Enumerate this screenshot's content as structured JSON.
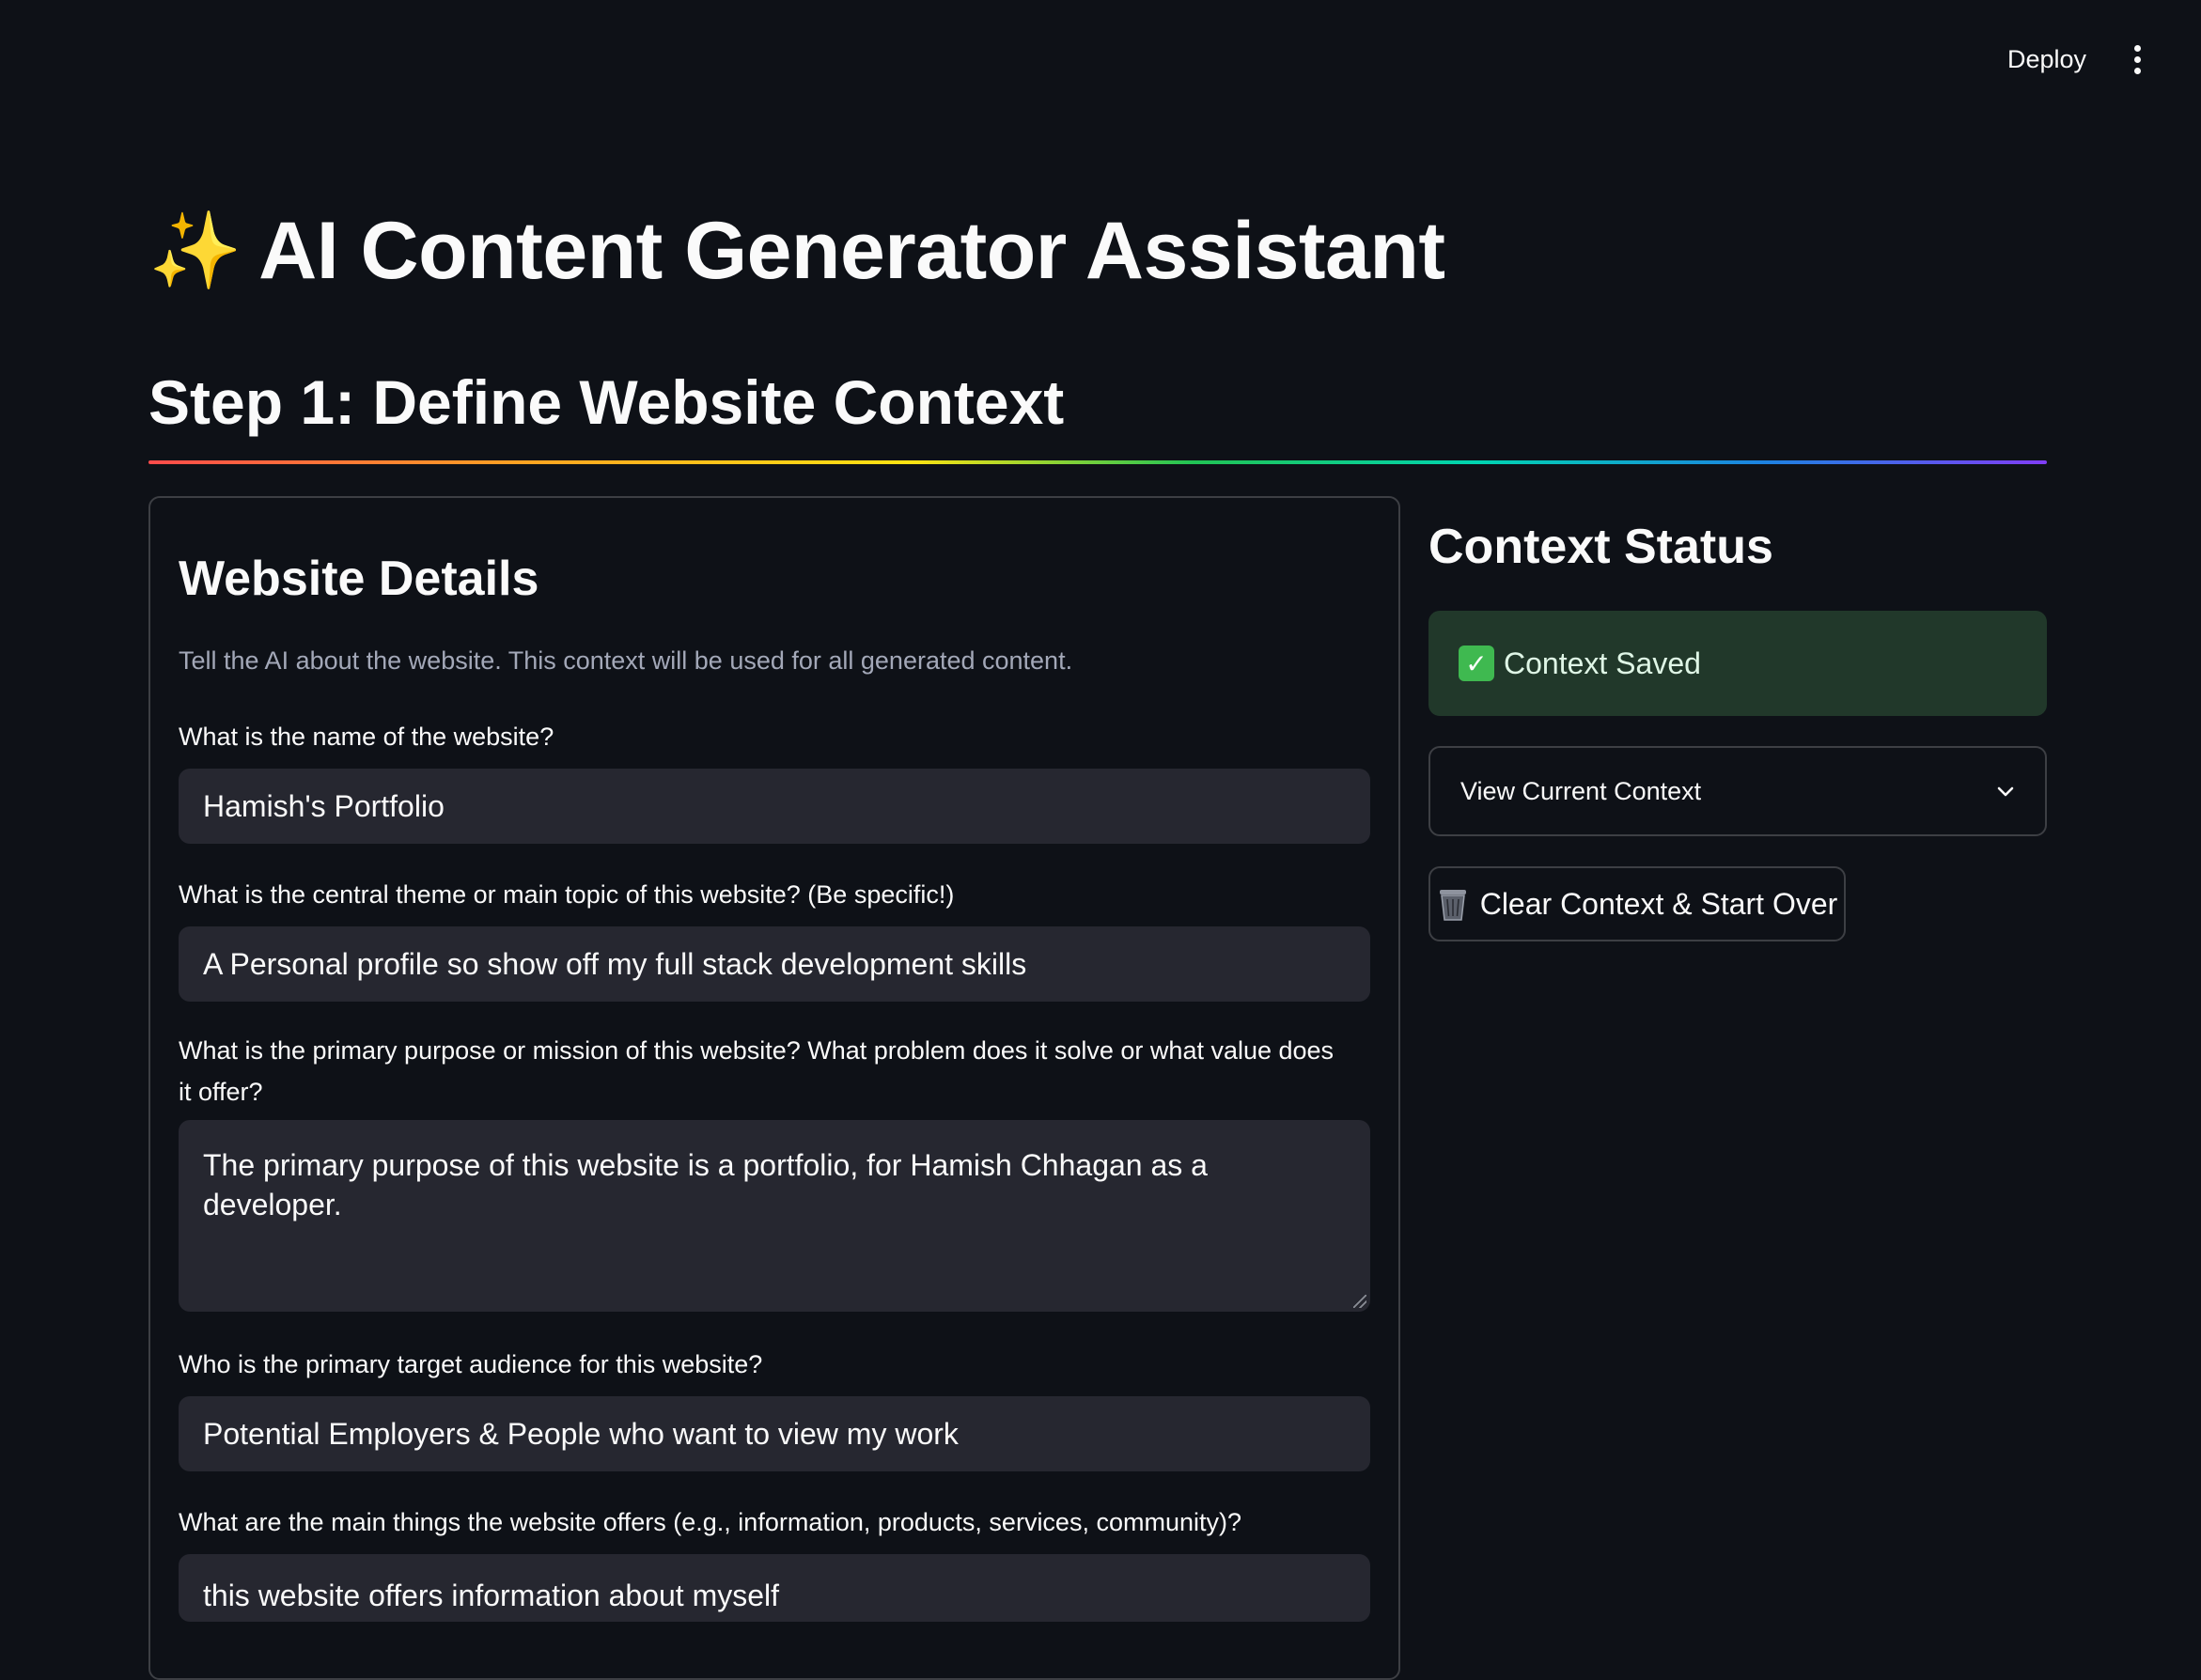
{
  "header": {
    "deploy_label": "Deploy",
    "menu_icon": "kebab-menu-icon"
  },
  "main": {
    "title": "AI Content Generator Assistant",
    "title_icon": "✨",
    "step_title": "Step 1: Define Website Context",
    "divider_colors": [
      "#ff4b4b",
      "#ffa421",
      "#ffe312",
      "#21c354",
      "#00d4b1",
      "#1c83e1",
      "#803df5"
    ]
  },
  "details": {
    "title": "Website Details",
    "caption": "Tell the AI about the website. This context will be used for all generated content.",
    "fields": [
      {
        "label": "What is the name of the website?",
        "value": "Hamish's Portfolio"
      },
      {
        "label": "What is the central theme or main topic of this website? (Be specific!)",
        "value": "A Personal profile so show off my full stack development skills"
      },
      {
        "label": "What is the primary purpose or mission of this website? What problem does it solve or what value does it offer?",
        "value": "The primary purpose of this website is a portfolio, for Hamish Chhagan as a developer."
      },
      {
        "label": "Who is the primary target audience for this website?",
        "value": "Potential Employers &  People who want to view my work"
      },
      {
        "label": "What are the main things the website offers (e.g., information, products, services, community)?",
        "value": "this website offers information about myself"
      }
    ]
  },
  "status": {
    "title": "Context Status",
    "saved_label": "Context Saved",
    "saved_icon": "✓",
    "saved_color": "#21382a",
    "expander_label": "View Current Context",
    "clear_button_label": "Clear Context & Start Over"
  }
}
